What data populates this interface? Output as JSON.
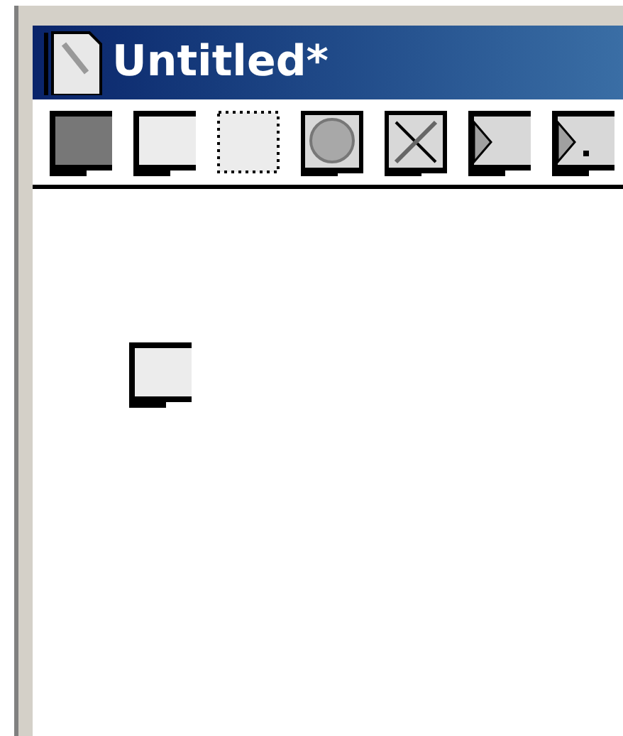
{
  "window": {
    "title": "Untitled*"
  }
}
